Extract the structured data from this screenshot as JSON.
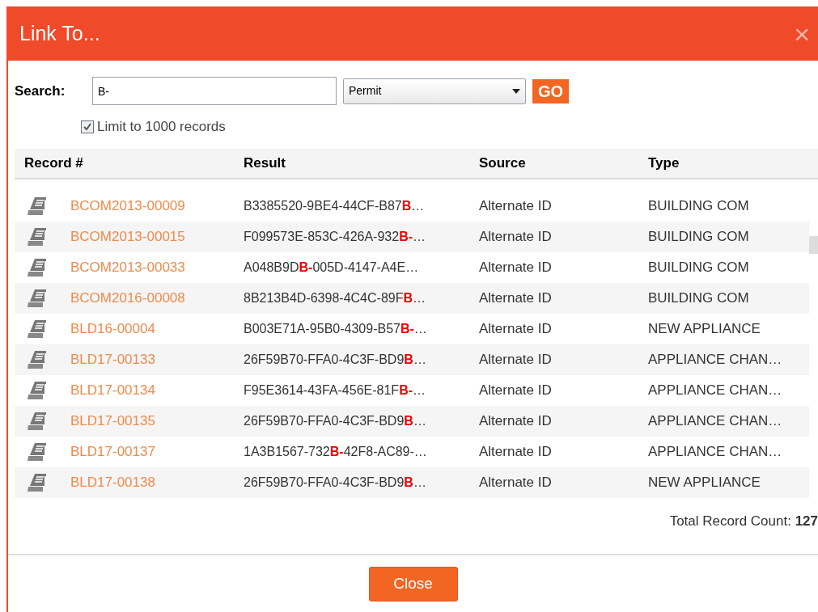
{
  "dialog": {
    "title": "Link To...",
    "close": "×"
  },
  "search": {
    "label": "Search:",
    "value": "B-",
    "category": "Permit",
    "go": "GO"
  },
  "limit": {
    "label": "Limit to 1000 records",
    "checked": true
  },
  "table": {
    "columns": [
      "Record #",
      "Result",
      "Source",
      "Type"
    ],
    "rows": [
      {
        "record": "BCOM2013-00009",
        "result": "B3385520-9BE4-44CF-B87**B**…",
        "source": "Alternate ID",
        "type": "BUILDING COM"
      },
      {
        "record": "BCOM2013-00015",
        "result": "F099573E-853C-426A-932**B-**…",
        "source": "Alternate ID",
        "type": "BUILDING COM"
      },
      {
        "record": "BCOM2013-00033",
        "result": "A048B9D**B-**005D-4147-A4E…",
        "source": "Alternate ID",
        "type": "BUILDING COM"
      },
      {
        "record": "BCOM2016-00008",
        "result": "8B213B4D-6398-4C4C-89F**B**…",
        "source": "Alternate ID",
        "type": "BUILDING COM"
      },
      {
        "record": "BLD16-00004",
        "result": "B003E71A-95B0-4309-B57**B-**…",
        "source": "Alternate ID",
        "type": "NEW APPLIANCE"
      },
      {
        "record": "BLD17-00133",
        "result": "26F59B70-FFA0-4C3F-BD9**B**…",
        "source": "Alternate ID",
        "type": "APPLIANCE CHAN…"
      },
      {
        "record": "BLD17-00134",
        "result": "F95E3614-43FA-456E-81F**B-**…",
        "source": "Alternate ID",
        "type": "APPLIANCE CHAN…"
      },
      {
        "record": "BLD17-00135",
        "result": "26F59B70-FFA0-4C3F-BD9**B**…",
        "source": "Alternate ID",
        "type": "APPLIANCE CHAN…"
      },
      {
        "record": "BLD17-00137",
        "result": "1A3B1567-732**B-**42F8-AC89-…",
        "source": "Alternate ID",
        "type": "APPLIANCE CHAN…"
      },
      {
        "record": "BLD17-00138",
        "result": "26F59B70-FFA0-4C3F-BD9**B**…",
        "source": "Alternate ID",
        "type": "NEW APPLIANCE"
      }
    ]
  },
  "total": "Total Record Count: **127**",
  "buttons": [
    "Close"
  ]
}
